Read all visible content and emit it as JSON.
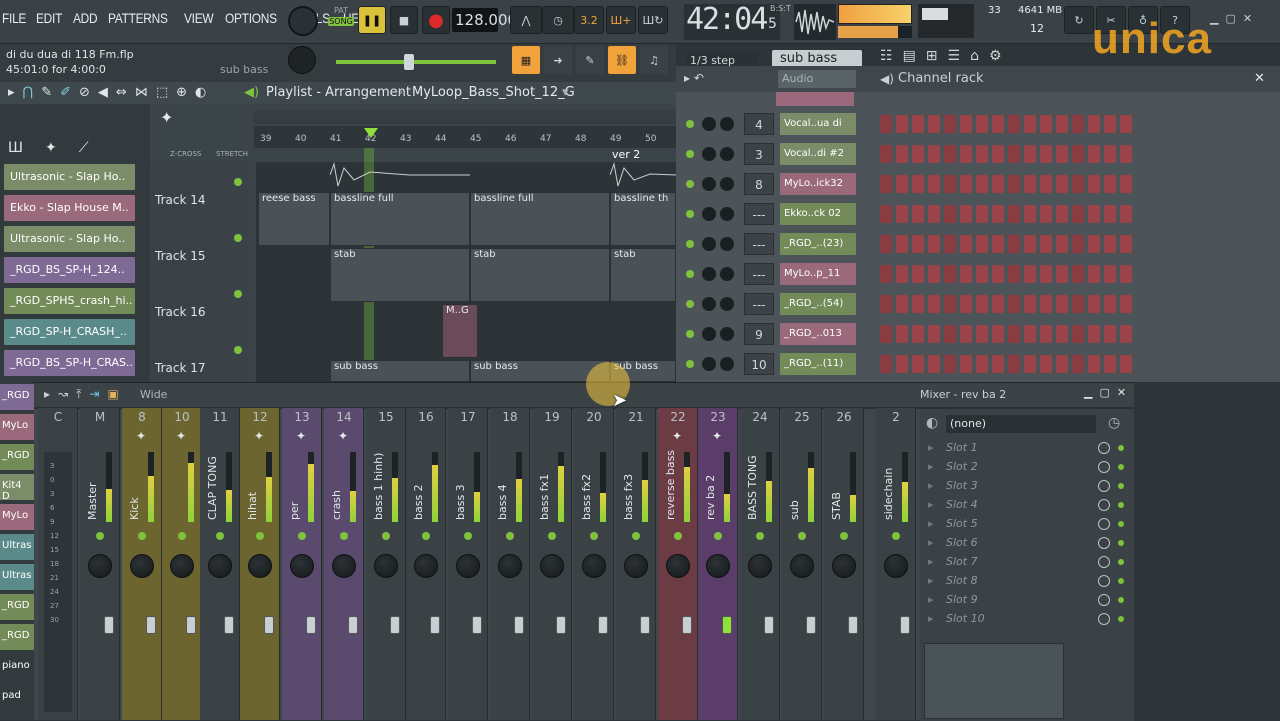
{
  "menu": [
    "FILE",
    "EDIT",
    "ADD",
    "PATTERNS",
    "VIEW",
    "OPTIONS",
    "TOOLS",
    "HELP"
  ],
  "transport": {
    "pat_label": "PAT",
    "song_label": "SONG",
    "tempo": "128.000",
    "clock": "42:04",
    "clock_frames": "5",
    "clock_unit": "B:S:T",
    "cpu": "33",
    "mem": "4641 MB",
    "voices": "12"
  },
  "project": {
    "file": "di du dua di 118 Fm.flp",
    "time": "45:01:0 for 4:00:0",
    "channel": "sub bass"
  },
  "step_label": "1/3 step",
  "selected_channel": "sub bass",
  "playlist": {
    "title": "Playlist - Arrangement",
    "pattern": "MyLoop_Bass_Shot_12_G",
    "zcross": "Z-CROSS",
    "stretch": "STRETCH",
    "ruler": [
      "39",
      "40",
      "41",
      "42",
      "43",
      "44",
      "45",
      "46",
      "47",
      "48",
      "49",
      "50"
    ],
    "marker": "ver 2",
    "tracks": [
      "Track 14",
      "Track 15",
      "Track 16",
      "Track 17"
    ],
    "clips": {
      "reese": "reese bass",
      "bassline1": "bassline full",
      "bassline2": "bassline full",
      "bassline3": "bassline th",
      "stab1": "stab",
      "stab2": "stab",
      "stab3": "stab",
      "mg": "M..G",
      "sub1": "sub bass",
      "sub2": "sub bass",
      "sub3": "sub bass"
    },
    "pattern_list": [
      "Ultrasonic - Slap Ho..",
      "Ekko - Slap House M..",
      "Ultrasonic - Slap Ho..",
      "_RGD_BS_SP-H_124..",
      "_RGD_SPHS_crash_hi..",
      "_RGD_SP-H_CRASH_..",
      "_RGD_BS_SP-H_CRAS.."
    ],
    "left_partial": [
      "_RGD",
      "MyLo",
      "_RGD",
      "Kit4 D",
      "MyLo",
      "Ultras",
      "Ultras",
      "_RGD",
      "_RGD",
      "piano",
      "pad"
    ]
  },
  "channel_rack": {
    "title": "Channel rack",
    "audio": "Audio",
    "rows": [
      {
        "num": "4",
        "name": "Vocal..ua di"
      },
      {
        "num": "3",
        "name": "Vocal..di #2"
      },
      {
        "num": "8",
        "name": "MyLo..ick32"
      },
      {
        "num": "---",
        "name": "Ekko..ck 02"
      },
      {
        "num": "---",
        "name": "_RGD_..(23)"
      },
      {
        "num": "---",
        "name": "MyLo..p_11"
      },
      {
        "num": "---",
        "name": "_RGD_..(54)"
      },
      {
        "num": "9",
        "name": "_RGD_..013"
      },
      {
        "num": "10",
        "name": "_RGD_..(11)"
      }
    ]
  },
  "mixer": {
    "title": "Mixer - rev ba 2",
    "preset": "Wide",
    "insert_select": "(none)",
    "strips": [
      {
        "num": "C",
        "label": ""
      },
      {
        "num": "M",
        "label": "Master"
      },
      {
        "num": "8",
        "label": "Kick"
      },
      {
        "num": "10",
        "label": ""
      },
      {
        "num": "11",
        "label": "CLAP TONG"
      },
      {
        "num": "12",
        "label": "hihat"
      },
      {
        "num": "13",
        "label": "per"
      },
      {
        "num": "14",
        "label": "crash"
      },
      {
        "num": "15",
        "label": "bass 1 hinh)"
      },
      {
        "num": "16",
        "label": "bass 2"
      },
      {
        "num": "17",
        "label": "bass 3"
      },
      {
        "num": "18",
        "label": "bass 4"
      },
      {
        "num": "19",
        "label": "bass fx1"
      },
      {
        "num": "20",
        "label": "bass fx2"
      },
      {
        "num": "21",
        "label": "bass fx3"
      },
      {
        "num": "22",
        "label": "reverse bass"
      },
      {
        "num": "23",
        "label": "rev ba 2"
      },
      {
        "num": "24",
        "label": "BASS TONG"
      },
      {
        "num": "25",
        "label": "sub"
      },
      {
        "num": "26",
        "label": "STAB"
      },
      {
        "num": "2",
        "label": "sidechain"
      }
    ],
    "slots": [
      "Slot 1",
      "Slot 2",
      "Slot 3",
      "Slot 4",
      "Slot 5",
      "Slot 6",
      "Slot 7",
      "Slot 8",
      "Slot 9",
      "Slot 10"
    ],
    "scale": [
      "3",
      "0",
      "3",
      "6",
      "9",
      "12",
      "15",
      "18",
      "21",
      "24",
      "27",
      "30"
    ]
  },
  "watermark": "unica",
  "brand_colors": {
    "accent_orange": "#f5a623",
    "pattern_green": "#7c8a6a",
    "mixer_selected": "#5a3d68",
    "step_red": "#9a4348"
  }
}
